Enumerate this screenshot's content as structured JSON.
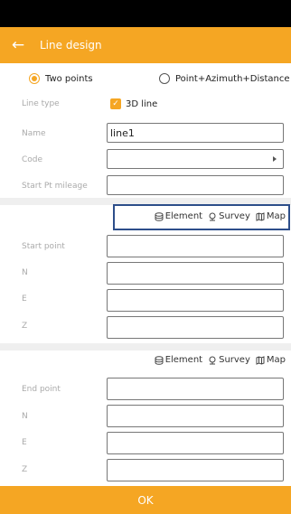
{
  "header": {
    "title": "Line design"
  },
  "mode": {
    "option1": "Two points",
    "option2": "Point+Azimuth+Distance",
    "selected": "Two points"
  },
  "form": {
    "line_type_label": "Line type",
    "line_type_value": "3D line",
    "line_type_checked": true,
    "name_label": "Name",
    "name_value": "line1",
    "code_label": "Code",
    "code_value": "",
    "start_mileage_label": "Start Pt mileage",
    "start_mileage_value": ""
  },
  "tools": {
    "element": "Element",
    "survey": "Survey",
    "map": "Map"
  },
  "start": {
    "label": "Start point",
    "n_label": "N",
    "e_label": "E",
    "z_label": "Z"
  },
  "end": {
    "label": "End point",
    "n_label": "N",
    "e_label": "E",
    "z_label": "Z"
  },
  "footer": {
    "ok_label": "OK"
  }
}
